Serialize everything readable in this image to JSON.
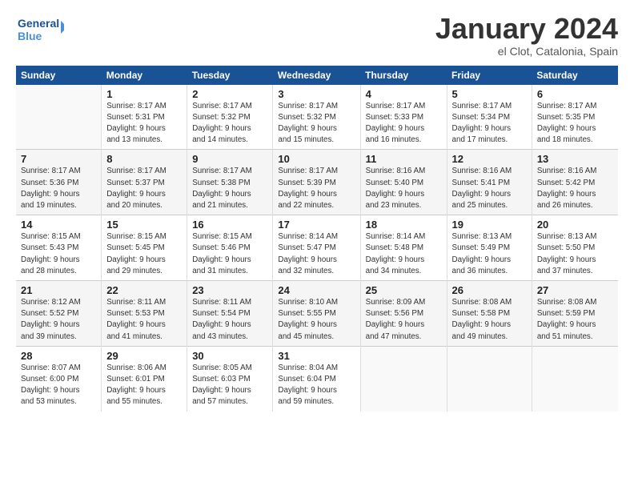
{
  "header": {
    "logo_line1": "General",
    "logo_line2": "Blue",
    "month": "January 2024",
    "location": "el Clot, Catalonia, Spain"
  },
  "weekdays": [
    "Sunday",
    "Monday",
    "Tuesday",
    "Wednesday",
    "Thursday",
    "Friday",
    "Saturday"
  ],
  "weeks": [
    [
      {
        "day": "",
        "info": ""
      },
      {
        "day": "1",
        "info": "Sunrise: 8:17 AM\nSunset: 5:31 PM\nDaylight: 9 hours\nand 13 minutes."
      },
      {
        "day": "2",
        "info": "Sunrise: 8:17 AM\nSunset: 5:32 PM\nDaylight: 9 hours\nand 14 minutes."
      },
      {
        "day": "3",
        "info": "Sunrise: 8:17 AM\nSunset: 5:32 PM\nDaylight: 9 hours\nand 15 minutes."
      },
      {
        "day": "4",
        "info": "Sunrise: 8:17 AM\nSunset: 5:33 PM\nDaylight: 9 hours\nand 16 minutes."
      },
      {
        "day": "5",
        "info": "Sunrise: 8:17 AM\nSunset: 5:34 PM\nDaylight: 9 hours\nand 17 minutes."
      },
      {
        "day": "6",
        "info": "Sunrise: 8:17 AM\nSunset: 5:35 PM\nDaylight: 9 hours\nand 18 minutes."
      }
    ],
    [
      {
        "day": "7",
        "info": "Sunrise: 8:17 AM\nSunset: 5:36 PM\nDaylight: 9 hours\nand 19 minutes."
      },
      {
        "day": "8",
        "info": "Sunrise: 8:17 AM\nSunset: 5:37 PM\nDaylight: 9 hours\nand 20 minutes."
      },
      {
        "day": "9",
        "info": "Sunrise: 8:17 AM\nSunset: 5:38 PM\nDaylight: 9 hours\nand 21 minutes."
      },
      {
        "day": "10",
        "info": "Sunrise: 8:17 AM\nSunset: 5:39 PM\nDaylight: 9 hours\nand 22 minutes."
      },
      {
        "day": "11",
        "info": "Sunrise: 8:16 AM\nSunset: 5:40 PM\nDaylight: 9 hours\nand 23 minutes."
      },
      {
        "day": "12",
        "info": "Sunrise: 8:16 AM\nSunset: 5:41 PM\nDaylight: 9 hours\nand 25 minutes."
      },
      {
        "day": "13",
        "info": "Sunrise: 8:16 AM\nSunset: 5:42 PM\nDaylight: 9 hours\nand 26 minutes."
      }
    ],
    [
      {
        "day": "14",
        "info": "Sunrise: 8:15 AM\nSunset: 5:43 PM\nDaylight: 9 hours\nand 28 minutes."
      },
      {
        "day": "15",
        "info": "Sunrise: 8:15 AM\nSunset: 5:45 PM\nDaylight: 9 hours\nand 29 minutes."
      },
      {
        "day": "16",
        "info": "Sunrise: 8:15 AM\nSunset: 5:46 PM\nDaylight: 9 hours\nand 31 minutes."
      },
      {
        "day": "17",
        "info": "Sunrise: 8:14 AM\nSunset: 5:47 PM\nDaylight: 9 hours\nand 32 minutes."
      },
      {
        "day": "18",
        "info": "Sunrise: 8:14 AM\nSunset: 5:48 PM\nDaylight: 9 hours\nand 34 minutes."
      },
      {
        "day": "19",
        "info": "Sunrise: 8:13 AM\nSunset: 5:49 PM\nDaylight: 9 hours\nand 36 minutes."
      },
      {
        "day": "20",
        "info": "Sunrise: 8:13 AM\nSunset: 5:50 PM\nDaylight: 9 hours\nand 37 minutes."
      }
    ],
    [
      {
        "day": "21",
        "info": "Sunrise: 8:12 AM\nSunset: 5:52 PM\nDaylight: 9 hours\nand 39 minutes."
      },
      {
        "day": "22",
        "info": "Sunrise: 8:11 AM\nSunset: 5:53 PM\nDaylight: 9 hours\nand 41 minutes."
      },
      {
        "day": "23",
        "info": "Sunrise: 8:11 AM\nSunset: 5:54 PM\nDaylight: 9 hours\nand 43 minutes."
      },
      {
        "day": "24",
        "info": "Sunrise: 8:10 AM\nSunset: 5:55 PM\nDaylight: 9 hours\nand 45 minutes."
      },
      {
        "day": "25",
        "info": "Sunrise: 8:09 AM\nSunset: 5:56 PM\nDaylight: 9 hours\nand 47 minutes."
      },
      {
        "day": "26",
        "info": "Sunrise: 8:08 AM\nSunset: 5:58 PM\nDaylight: 9 hours\nand 49 minutes."
      },
      {
        "day": "27",
        "info": "Sunrise: 8:08 AM\nSunset: 5:59 PM\nDaylight: 9 hours\nand 51 minutes."
      }
    ],
    [
      {
        "day": "28",
        "info": "Sunrise: 8:07 AM\nSunset: 6:00 PM\nDaylight: 9 hours\nand 53 minutes."
      },
      {
        "day": "29",
        "info": "Sunrise: 8:06 AM\nSunset: 6:01 PM\nDaylight: 9 hours\nand 55 minutes."
      },
      {
        "day": "30",
        "info": "Sunrise: 8:05 AM\nSunset: 6:03 PM\nDaylight: 9 hours\nand 57 minutes."
      },
      {
        "day": "31",
        "info": "Sunrise: 8:04 AM\nSunset: 6:04 PM\nDaylight: 9 hours\nand 59 minutes."
      },
      {
        "day": "",
        "info": ""
      },
      {
        "day": "",
        "info": ""
      },
      {
        "day": "",
        "info": ""
      }
    ]
  ]
}
